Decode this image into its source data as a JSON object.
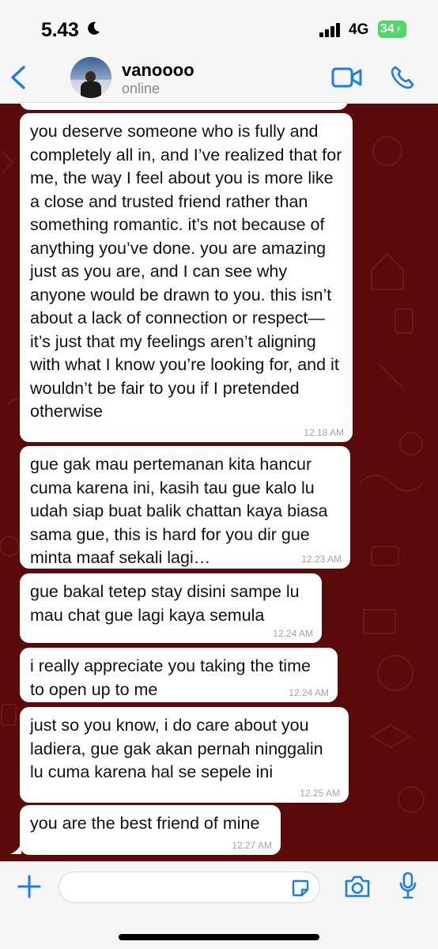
{
  "status_bar": {
    "time": "5.43",
    "network": "4G",
    "battery": "34",
    "icons": [
      "moon-icon",
      "signal-icon",
      "charging-icon"
    ]
  },
  "header": {
    "contact_name": "vanoooo",
    "contact_status": "online",
    "icons": [
      "chevron-left-icon",
      "video-icon",
      "phone-icon"
    ]
  },
  "colors": {
    "accent": "#1a7cf5",
    "chat_background": "#5a0a08",
    "bubble": "#ffffff",
    "battery": "#4cd964"
  },
  "messages": [
    {
      "text": "you deserve someone who is fully and completely all in, and I’ve realized that for me, the way I feel about you is more like a close and trusted friend rather than something romantic. it’s not because of anything you’ve done. you are amazing just as you are, and I can see why anyone would be drawn to you. this isn’t about a lack of connection or respect—it’s just that my feelings aren’t aligning with what I know you’re looking for, and it wouldn’t be fair to you if I pretended otherwise",
      "time": "12.18 AM"
    },
    {
      "text": "gue gak mau pertemanan kita hancur cuma karena ini, kasih tau gue kalo lu udah siap buat balik chattan kaya biasa sama gue, this is hard for you dir gue minta maaf sekali lagi…",
      "time": "12.23 AM"
    },
    {
      "text": "gue bakal tetep stay disini sampe lu mau chat gue lagi kaya semula",
      "time": "12.24 AM"
    },
    {
      "text": "i really appreciate you taking the time to open up to me",
      "time": "12.24 AM"
    },
    {
      "text": "just so you know, i do care about you ladiera, gue gak akan pernah ninggalin lu cuma karena hal se sepele ini",
      "time": "12.25 AM"
    },
    {
      "text": "you are the best friend of mine",
      "time": "12.27 AM"
    }
  ],
  "composer": {
    "value": "",
    "icons": [
      "plus-icon",
      "sticker-icon",
      "camera-icon",
      "microphone-icon"
    ]
  }
}
